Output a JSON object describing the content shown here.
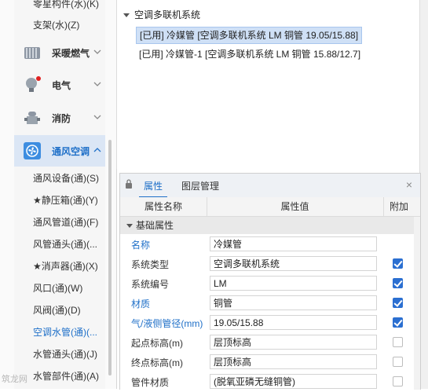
{
  "sidebar": {
    "top_items": [
      "零星构件(水)(K)",
      "支架(水)(Z)"
    ],
    "categories": [
      {
        "label": "采暖燃气",
        "icon": "radiator-icon"
      },
      {
        "label": "电气",
        "icon": "lightbulb-icon"
      },
      {
        "label": "消防",
        "icon": "fire-hydrant-icon"
      },
      {
        "label": "通风空调",
        "icon": "fan-icon"
      }
    ],
    "sub_items": [
      "通风设备(通)(S)",
      "★静压箱(通)(Y)",
      "通风管道(通)(F)",
      "风管通头(通)(...",
      "★消声器(通)(X)",
      "风口(通)(W)",
      "风阀(通)(D)",
      "空调水管(通)(...",
      "水管通头(通)(J)",
      "水管部件(通)(A)"
    ],
    "active_sub_index": 7,
    "colors": {
      "accent": "#1e6fc8",
      "notification_dot": "#e02020"
    }
  },
  "tree": {
    "root": "空调多联机系统",
    "nodes": [
      "[已用] 冷媒管 [空调多联机系统 LM 铜管 19.05/15.88]",
      "[已用] 冷媒管-1 [空调多联机系统 LM 铜管 15.88/12.7]"
    ]
  },
  "props": {
    "tabs": [
      "属性",
      "图层管理"
    ],
    "headers": [
      "属性名称",
      "属性值",
      "附加"
    ],
    "group": "基础属性",
    "rows": [
      {
        "name": "名称",
        "value": "冷媒管",
        "blue": true,
        "checkbox": null
      },
      {
        "name": "系统类型",
        "value": "空调多联机系统",
        "blue": false,
        "checkbox": true
      },
      {
        "name": "系统编号",
        "value": "LM",
        "blue": false,
        "checkbox": true
      },
      {
        "name": "材质",
        "value": "铜管",
        "blue": true,
        "checkbox": true
      },
      {
        "name": "气/液侧管径(mm)",
        "value": "19.05/15.88",
        "blue": true,
        "checkbox": true
      },
      {
        "name": "起点标高(m)",
        "value": "层顶标高",
        "blue": false,
        "checkbox": false
      },
      {
        "name": "终点标高(m)",
        "value": "层顶标高",
        "blue": false,
        "checkbox": false
      },
      {
        "name": "管件材质",
        "value": "(脱氧亚磷无缝铜管)",
        "blue": false,
        "checkbox": false
      }
    ]
  },
  "watermark": "筑龙网"
}
